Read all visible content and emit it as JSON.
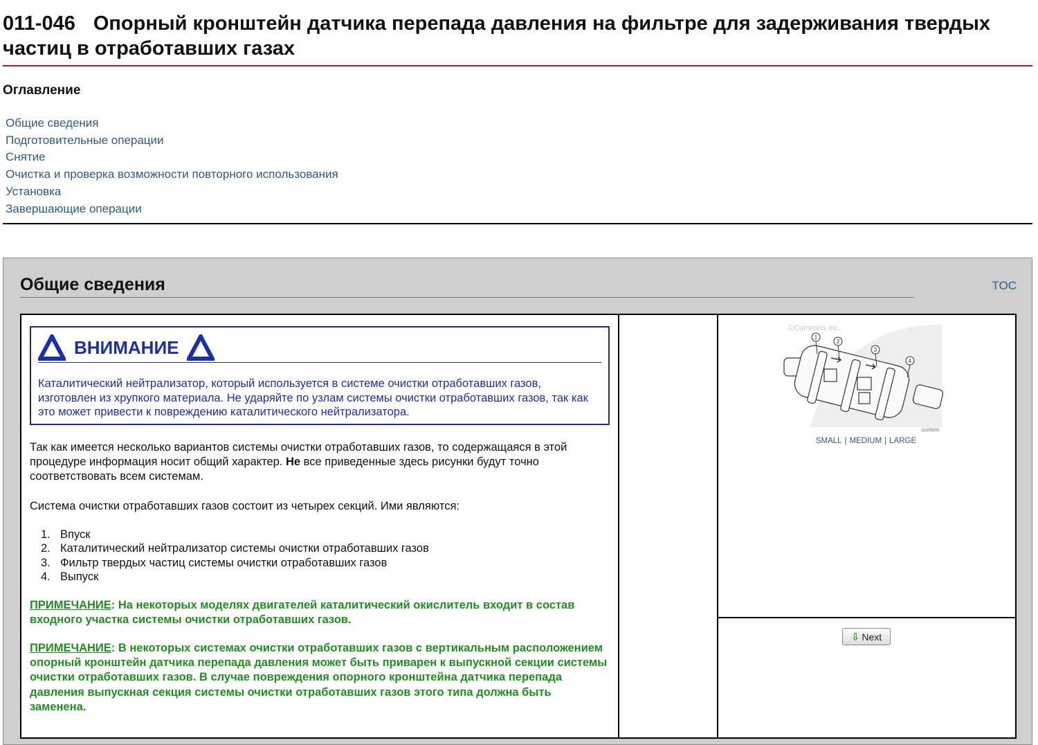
{
  "document": {
    "code": "011-046",
    "title": "Опорный кронштейн датчика перепада давления на фильтре для задерживания твердых частиц в отработавших газах"
  },
  "toc": {
    "heading": "Оглавление",
    "items": [
      "Общие сведения",
      "Подготовительные операции",
      "Снятие",
      "Очистка и проверка возможности повторного использования",
      "Установка",
      "Завершающие операции"
    ]
  },
  "section": {
    "title": "Общие сведения",
    "toc_link": "TOC",
    "warning": {
      "label": "ВНИМАНИЕ",
      "text": "Каталитический нейтрализатор, который используется в системе очистки отработавших газов, изготовлен из хрупкого материала. Не ударяйте по узлам системы очистки отработавших газов, так как это может привести к повреждению каталитического нейтрализатора."
    },
    "intro": {
      "part1": "Так как имеется несколько вариантов системы очистки отработавших газов, то содержащаяся в этой процедуре информация носит общий характер. ",
      "bold": "Не",
      "part2": " все приведенные здесь рисунки будут точно соответствовать всем системам."
    },
    "sections_intro": "Система очистки отработавших газов состоит из четырех секций. Ими являются:",
    "steps": [
      {
        "num": "1.",
        "text": "Впуск"
      },
      {
        "num": "2.",
        "text": "Каталитический нейтрализатор системы очистки отработавших газов"
      },
      {
        "num": "3.",
        "text": "Фильтр твердых частиц системы очистки отработавших газов"
      },
      {
        "num": "4.",
        "text": "Выпуск"
      }
    ],
    "notes": [
      {
        "label": "ПРИМЕЧАНИЕ",
        "text": ": На некоторых моделях двигателей каталитический окислитель входит в состав входного участка системы очистки отработавших газов."
      },
      {
        "label": "ПРИМЕЧАНИЕ",
        "text": ": В некоторых системах очистки отработавших газов с вертикальным расположением опорный кронштейн датчика перепада давления может быть приварен к выпускной секции системы очистки отработавших газов. В случае повреждения опорного кронштейна датчика перепада давления выпускная секция системы очистки отработавших газов этого типа должна быть заменена."
      }
    ],
    "figure": {
      "watermark": "©Cummins Inc.",
      "callouts": [
        "1",
        "2",
        "3",
        "4"
      ],
      "fig_id": "11c00100",
      "size_links": {
        "small": "SMALL",
        "medium": "MEDIUM",
        "large": "LARGE",
        "separator": "|"
      }
    },
    "next_button": "Next"
  },
  "colors": {
    "link": "#2c5a8a",
    "title_rule": "#b4123a",
    "warning": "#1a2fb0",
    "note": "#1f8f1f",
    "frame_bg": "#cfcfcf"
  }
}
